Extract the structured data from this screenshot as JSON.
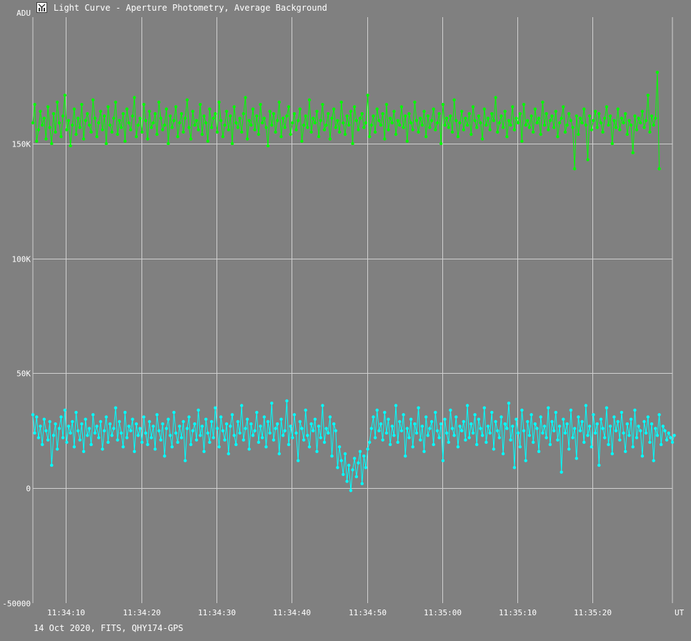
{
  "window": {
    "title": "Light Curve - Aperture Photometry, Average Background",
    "icon": "light-curve-app-icon"
  },
  "footer": {
    "caption": "14 Oct 2020, FITS, QHY174-GPS"
  },
  "colors": {
    "background": "#808080",
    "grid": "#d0d0d0",
    "series_target": "#00ff00",
    "series_comparison": "#00ffff"
  },
  "chart_data": {
    "type": "line",
    "title": "Light Curve - Aperture Photometry, Average Background",
    "xlabel": "UT",
    "ylabel": "ADU",
    "grid": true,
    "xlim": [
      "11:34:05.6",
      "11:35:30.6"
    ],
    "ylim": [
      -50000,
      205000
    ],
    "x_ticks": [
      "11:34:10",
      "11:34:20",
      "11:34:30",
      "11:34:40",
      "11:34:50",
      "11:35:00",
      "11:35:10",
      "11:35:20"
    ],
    "y_ticks": [
      {
        "value": 150000,
        "label": "150K"
      },
      {
        "value": 100000,
        "label": "100K"
      },
      {
        "value": 50000,
        "label": "50K"
      },
      {
        "value": 0,
        "label": "0"
      },
      {
        "value": -50000,
        "label": "-50000"
      }
    ],
    "sample_interval_s": 0.25,
    "series": [
      {
        "values": [
          159000,
          167000,
          151000,
          156000,
          164000,
          158000,
          161000,
          152000,
          166000,
          157000,
          150000,
          163000,
          155000,
          168000,
          159000,
          153000,
          162000,
          171000,
          156000,
          160000,
          149000,
          158000,
          165000,
          154000,
          161000,
          157000,
          167000,
          152000,
          160000,
          163000,
          158000,
          155000,
          169000,
          161000,
          153000,
          159000,
          164000,
          156000,
          162000,
          150000,
          166000,
          158000,
          155000,
          161000,
          168000,
          154000,
          160000,
          157000,
          163000,
          151000,
          165000,
          159000,
          156000,
          162000,
          170000,
          153000,
          158000,
          161000,
          155000,
          167000,
          160000,
          152000,
          164000,
          157000,
          159000,
          163000,
          154000,
          168000,
          161000,
          156000,
          158000,
          165000,
          150000,
          162000,
          157000,
          160000,
          166000,
          153000,
          159000,
          163000,
          155000,
          161000,
          169000,
          157000,
          152000,
          164000,
          158000,
          160000,
          156000,
          167000,
          154000,
          162000,
          159000,
          151000,
          165000,
          157000,
          161000,
          163000,
          155000,
          168000,
          160000,
          153000,
          158000,
          164000,
          156000,
          162000,
          150000,
          166000,
          159000,
          157000,
          161000,
          155000,
          163000,
          170000,
          152000,
          160000,
          158000,
          165000,
          156000,
          162000,
          154000,
          167000,
          159000,
          161000,
          157000,
          149000,
          164000,
          158000,
          163000,
          155000,
          160000,
          168000,
          153000,
          161000,
          157000,
          162000,
          166000,
          154000,
          159000,
          163000,
          156000,
          160000,
          165000,
          151000,
          158000,
          162000,
          157000,
          169000,
          155000,
          161000,
          159000,
          164000,
          153000,
          160000,
          167000,
          156000,
          158000,
          163000,
          152000,
          161000,
          165000,
          157000,
          160000,
          155000,
          168000,
          159000,
          154000,
          162000,
          158000,
          164000,
          150000,
          166000,
          160000,
          156000,
          161000,
          163000,
          157000,
          159000,
          171000,
          153000,
          158000,
          162000,
          155000,
          165000,
          160000,
          158000,
          163000,
          152000,
          167000,
          156000,
          161000,
          159000,
          164000,
          154000,
          160000,
          158000,
          166000,
          157000,
          162000,
          151000,
          163000,
          159000,
          156000,
          168000,
          160000,
          155000,
          161000,
          158000,
          164000,
          153000,
          162000,
          157000,
          160000,
          165000,
          156000,
          159000,
          163000,
          150000,
          167000,
          158000,
          161000,
          157000,
          162000,
          155000,
          169000,
          160000,
          153000,
          159000,
          164000,
          156000,
          161000,
          158000,
          163000,
          154000,
          166000,
          160000,
          157000,
          162000,
          159000,
          152000,
          165000,
          158000,
          161000,
          156000,
          163000,
          160000,
          170000,
          155000,
          159000,
          162000,
          157000,
          164000,
          153000,
          160000,
          158000,
          166000,
          156000,
          161000,
          159000,
          163000,
          151000,
          167000,
          158000,
          160000,
          157000,
          162000,
          155000,
          165000,
          159000,
          161000,
          154000,
          168000,
          158000,
          163000,
          156000,
          160000,
          162000,
          157000,
          164000,
          153000,
          159000,
          161000,
          166000,
          155000,
          158000,
          163000,
          160000,
          157000,
          139000,
          162000,
          154000,
          161000,
          159000,
          165000,
          158000,
          143000,
          162000,
          156000,
          160000,
          164000,
          157000,
          163000,
          159000,
          155000,
          161000,
          166000,
          158000,
          162000,
          150000,
          160000,
          157000,
          165000,
          156000,
          161000,
          159000,
          163000,
          154000,
          160000,
          158000,
          146000,
          162000,
          156000,
          161000,
          159000,
          164000,
          157000,
          160000,
          171000,
          155000,
          162000,
          158000,
          161000,
          181000,
          139000
        ]
      },
      {
        "values": [
          32000,
          24000,
          31000,
          22000,
          27000,
          19000,
          30000,
          25000,
          21000,
          29000,
          10000,
          23000,
          28000,
          17000,
          26000,
          31000,
          22000,
          34000,
          20000,
          27000,
          24000,
          29000,
          18000,
          33000,
          25000,
          21000,
          28000,
          16000,
          30000,
          23000,
          26000,
          19000,
          32000,
          24000,
          27000,
          22000,
          29000,
          17000,
          25000,
          31000,
          20000,
          28000,
          23000,
          26000,
          35000,
          21000,
          29000,
          24000,
          18000,
          33000,
          22000,
          27000,
          25000,
          30000,
          16000,
          28000,
          23000,
          26000,
          20000,
          31000,
          24000,
          19000,
          29000,
          22000,
          27000,
          17000,
          32000,
          25000,
          21000,
          28000,
          14000,
          26000,
          30000,
          23000,
          18000,
          33000,
          24000,
          20000,
          27000,
          22000,
          29000,
          12000,
          26000,
          31000,
          19000,
          25000,
          28000,
          21000,
          34000,
          23000,
          27000,
          16000,
          30000,
          24000,
          20000,
          29000,
          22000,
          35000,
          26000,
          18000,
          31000,
          25000,
          21000,
          28000,
          15000,
          27000,
          32000,
          23000,
          19000,
          29000,
          24000,
          36000,
          21000,
          26000,
          30000,
          17000,
          28000,
          23000,
          25000,
          33000,
          20000,
          27000,
          22000,
          31000,
          18000,
          29000,
          24000,
          37000,
          21000,
          26000,
          28000,
          15000,
          30000,
          23000,
          25000,
          38000,
          19000,
          27000,
          22000,
          32000,
          24000,
          12000,
          29000,
          26000,
          21000,
          34000,
          23000,
          18000,
          28000,
          25000,
          30000,
          16000,
          27000,
          22000,
          36000,
          20000,
          26000,
          24000,
          31000,
          14000,
          28000,
          25000,
          9000,
          18000,
          12000,
          6000,
          15000,
          3000,
          10000,
          -1000,
          8000,
          13000,
          5000,
          11000,
          16000,
          2000,
          14000,
          9000,
          17000,
          20000,
          26000,
          31000,
          22000,
          34000,
          25000,
          28000,
          21000,
          33000,
          24000,
          30000,
          19000,
          27000,
          23000,
          36000,
          20000,
          29000,
          25000,
          32000,
          14000,
          26000,
          22000,
          30000,
          18000,
          28000,
          24000,
          35000,
          21000,
          27000,
          16000,
          31000,
          23000,
          26000,
          29000,
          19000,
          33000,
          25000,
          22000,
          28000,
          12000,
          30000,
          24000,
          20000,
          34000,
          26000,
          23000,
          31000,
          18000,
          27000,
          25000,
          29000,
          21000,
          36000,
          22000,
          28000,
          24000,
          32000,
          19000,
          30000,
          26000,
          23000,
          35000,
          20000,
          27000,
          24000,
          33000,
          17000,
          29000,
          25000,
          22000,
          31000,
          15000,
          28000,
          26000,
          37000,
          21000,
          27000,
          9000,
          30000,
          24000,
          18000,
          34000,
          25000,
          12000,
          29000,
          23000,
          32000,
          20000,
          28000,
          26000,
          16000,
          31000,
          24000,
          27000,
          22000,
          35000,
          19000,
          29000,
          25000,
          33000,
          21000,
          27000,
          7000,
          30000,
          24000,
          28000,
          17000,
          34000,
          22000,
          26000,
          13000,
          31000,
          25000,
          29000,
          20000,
          36000,
          23000,
          27000,
          18000,
          32000,
          24000,
          28000,
          10000,
          30000,
          26000,
          22000,
          35000,
          19000,
          27000,
          15000,
          31000,
          25000,
          29000,
          21000,
          33000,
          24000,
          16000,
          28000,
          23000,
          30000,
          18000,
          34000,
          22000,
          27000,
          25000,
          14000,
          29000,
          24000,
          31000,
          20000,
          28000,
          12000,
          26000,
          23000,
          32000,
          19000,
          27000,
          25000,
          21000,
          24000,
          22000,
          20000,
          23000
        ]
      }
    ]
  }
}
